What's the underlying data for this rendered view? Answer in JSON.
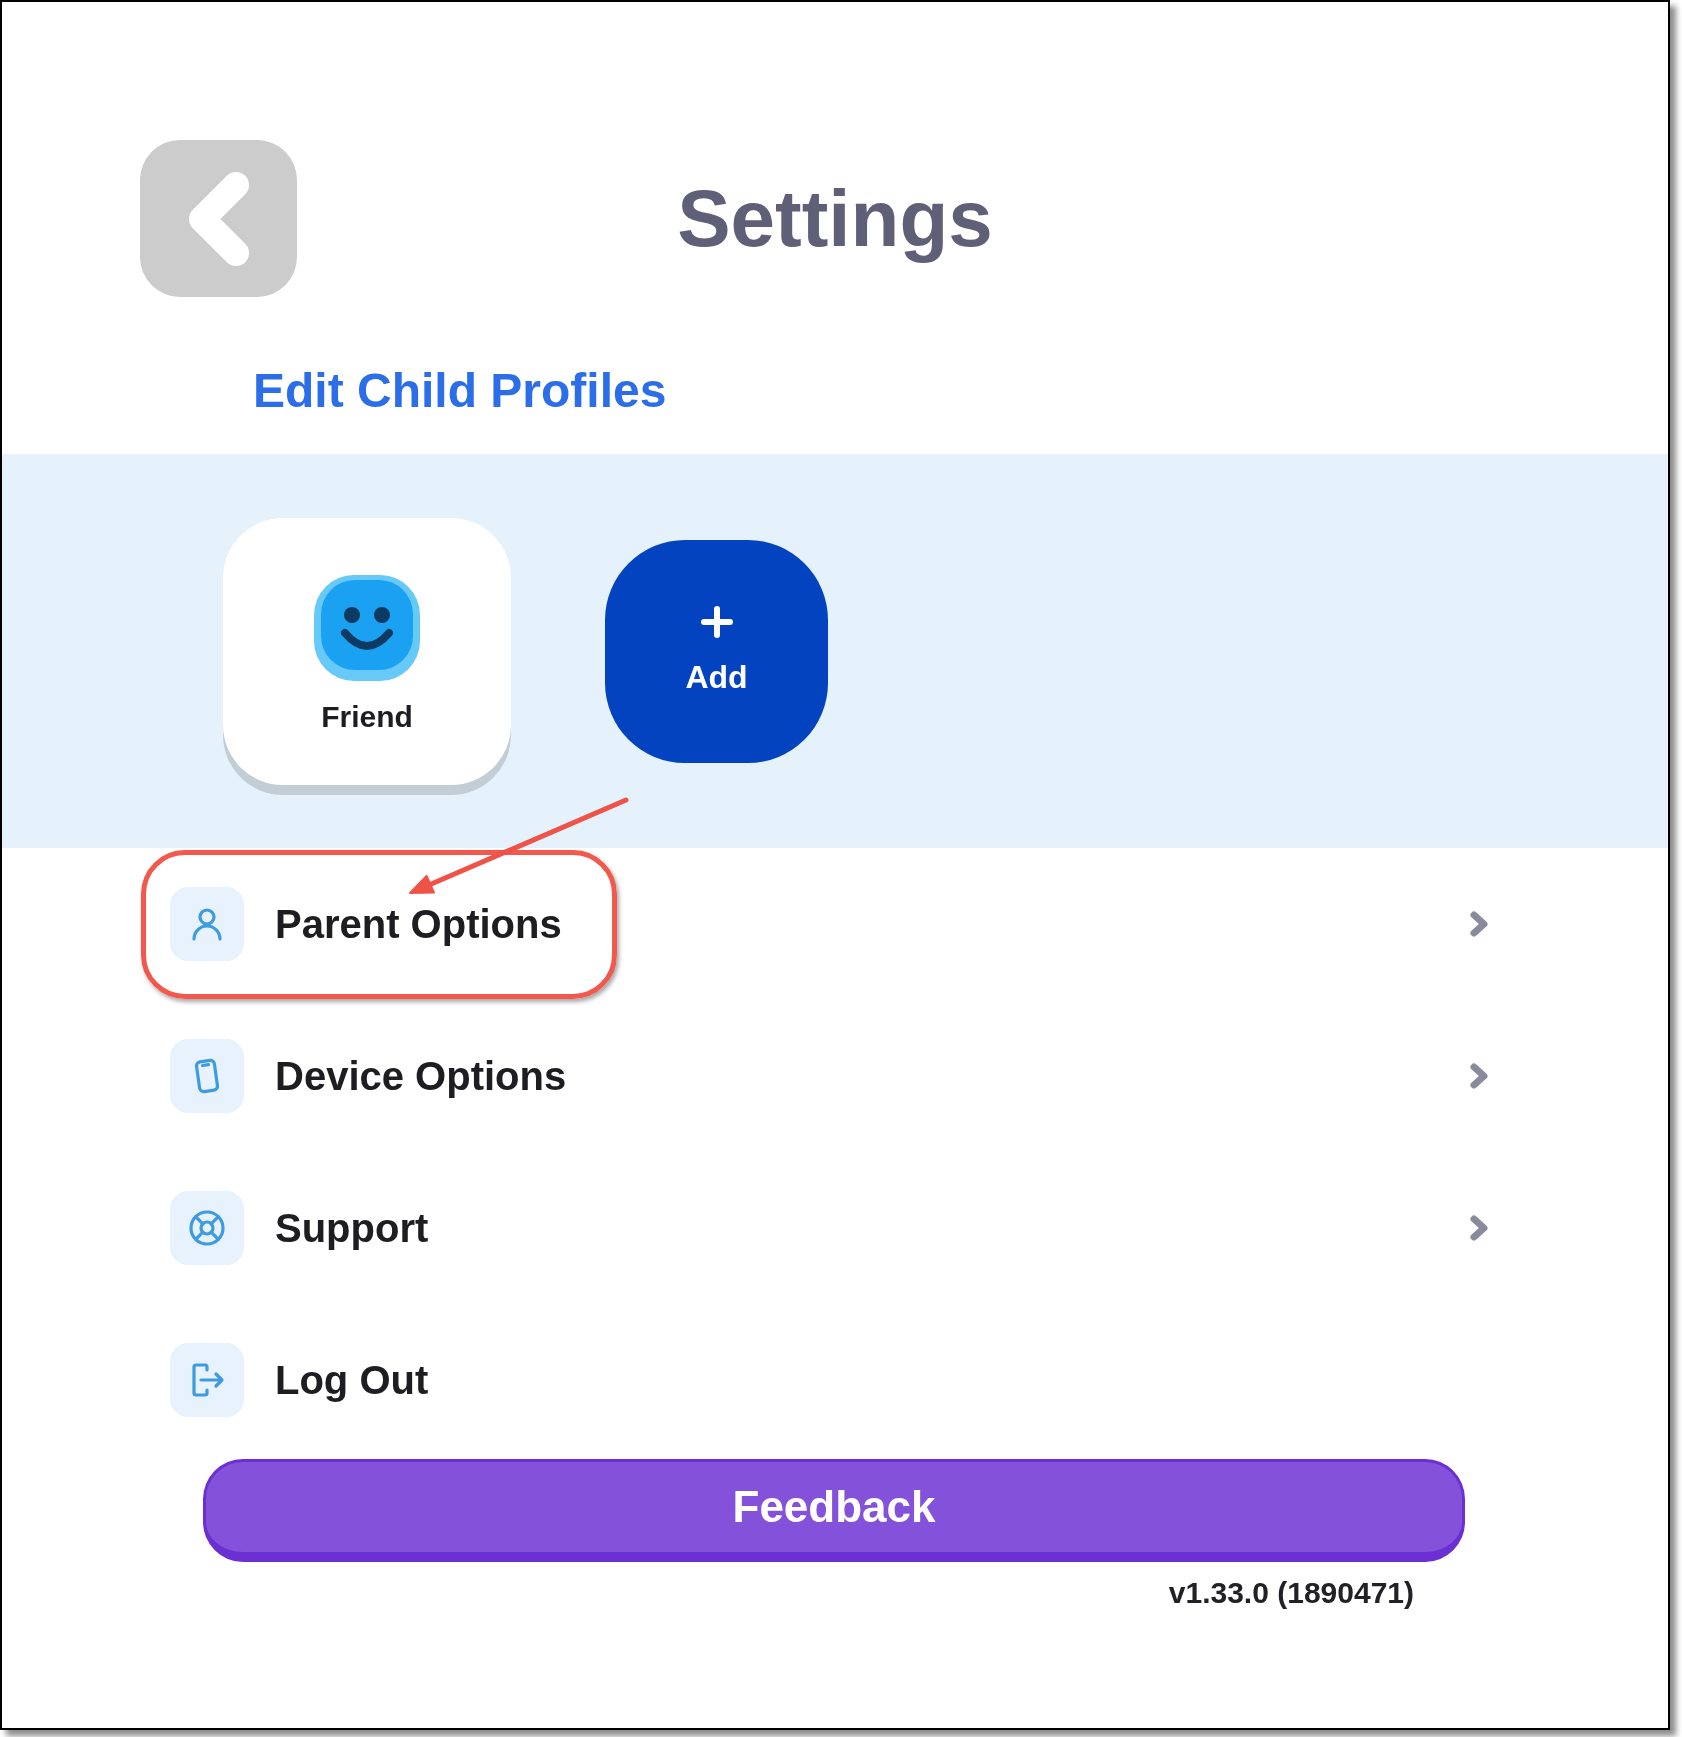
{
  "header": {
    "title": "Settings"
  },
  "profiles": {
    "heading": "Edit Child Profiles",
    "items": [
      {
        "kind": "profile",
        "label": "Friend"
      },
      {
        "kind": "add",
        "label": "Add"
      }
    ]
  },
  "menu": [
    {
      "label": "Parent Options",
      "chevron": true,
      "highlighted": true
    },
    {
      "label": "Device Options",
      "chevron": true,
      "highlighted": false
    },
    {
      "label": "Support",
      "chevron": true,
      "highlighted": false
    },
    {
      "label": "Log Out",
      "chevron": false,
      "highlighted": false
    }
  ],
  "feedback_button": {
    "label": "Feedback"
  },
  "version": "v1.33.0 (1890471)"
}
